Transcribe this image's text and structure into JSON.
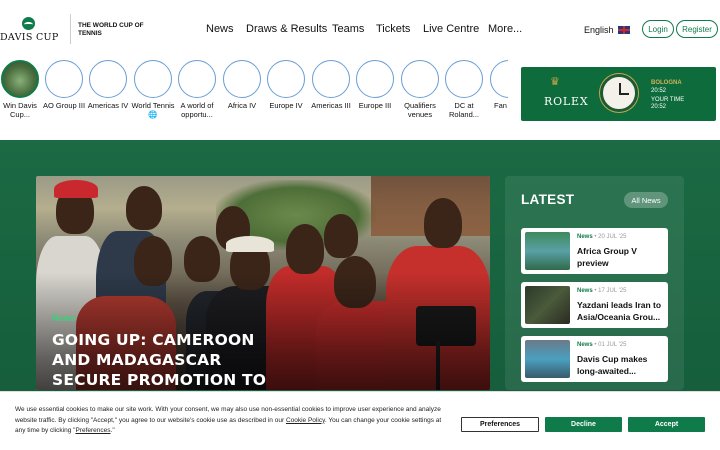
{
  "brand": {
    "logo_text": "DAVIS CUP",
    "tagline": "THE WORLD CUP OF TENNIS"
  },
  "nav": {
    "items": [
      "News",
      "Draws & Results",
      "Teams",
      "Tickets",
      "Live Centre",
      "More..."
    ]
  },
  "header": {
    "language": "English",
    "login_label": "Login",
    "register_label": "Register"
  },
  "stories": [
    {
      "label": "Win Davis Cup..."
    },
    {
      "label": "AO Group III"
    },
    {
      "label": "Americas IV"
    },
    {
      "label": "World Tennis 🌐"
    },
    {
      "label": "A world of opportu..."
    },
    {
      "label": "Africa IV"
    },
    {
      "label": "Europe IV"
    },
    {
      "label": "Americas III"
    },
    {
      "label": "Europe III"
    },
    {
      "label": "Qualifiers venues"
    },
    {
      "label": "DC at Roland..."
    },
    {
      "label": "Fan Fo..."
    }
  ],
  "ad": {
    "brand": "ROLEX",
    "city": "BOLOGNA",
    "city_time": "20:52",
    "your_time_label": "YOUR TIME",
    "your_time": "20:52"
  },
  "hero": {
    "tag": "News",
    "title": "GOING UP: CAMEROON AND MADAGASCAR SECURE PROMOTION TO AFRICA IV"
  },
  "latest": {
    "title": "LATEST",
    "all_news_label": "All News",
    "cards": [
      {
        "tag": "News",
        "date": "• 20 JUL '25",
        "title": "Africa Group V preview"
      },
      {
        "tag": "News",
        "date": "• 17 JUL '25",
        "title": "Yazdani leads Iran to Asia/Oceania Grou..."
      },
      {
        "tag": "News",
        "date": "• 01 JUL '25",
        "title": "Davis Cup makes long-awaited..."
      }
    ]
  },
  "cookie": {
    "text_1": "We use essential cookies to make our site work. With your consent, we may also use non-essential cookies to improve user experience and analyze website traffic. By clicking \"Accept,\" you agree to our website's cookie use as described in our ",
    "policy_link": "Cookie Policy",
    "text_2": ". You can change your cookie settings at any time by clicking \"",
    "preferences_link": "Preferences",
    "text_3": ".\"",
    "preferences_label": "Preferences",
    "decline_label": "Decline",
    "accept_label": "Accept"
  },
  "colors": {
    "brand_green": "#0f7a4a",
    "section_green": "#1b6a44",
    "accent_green": "#3ad17a"
  }
}
